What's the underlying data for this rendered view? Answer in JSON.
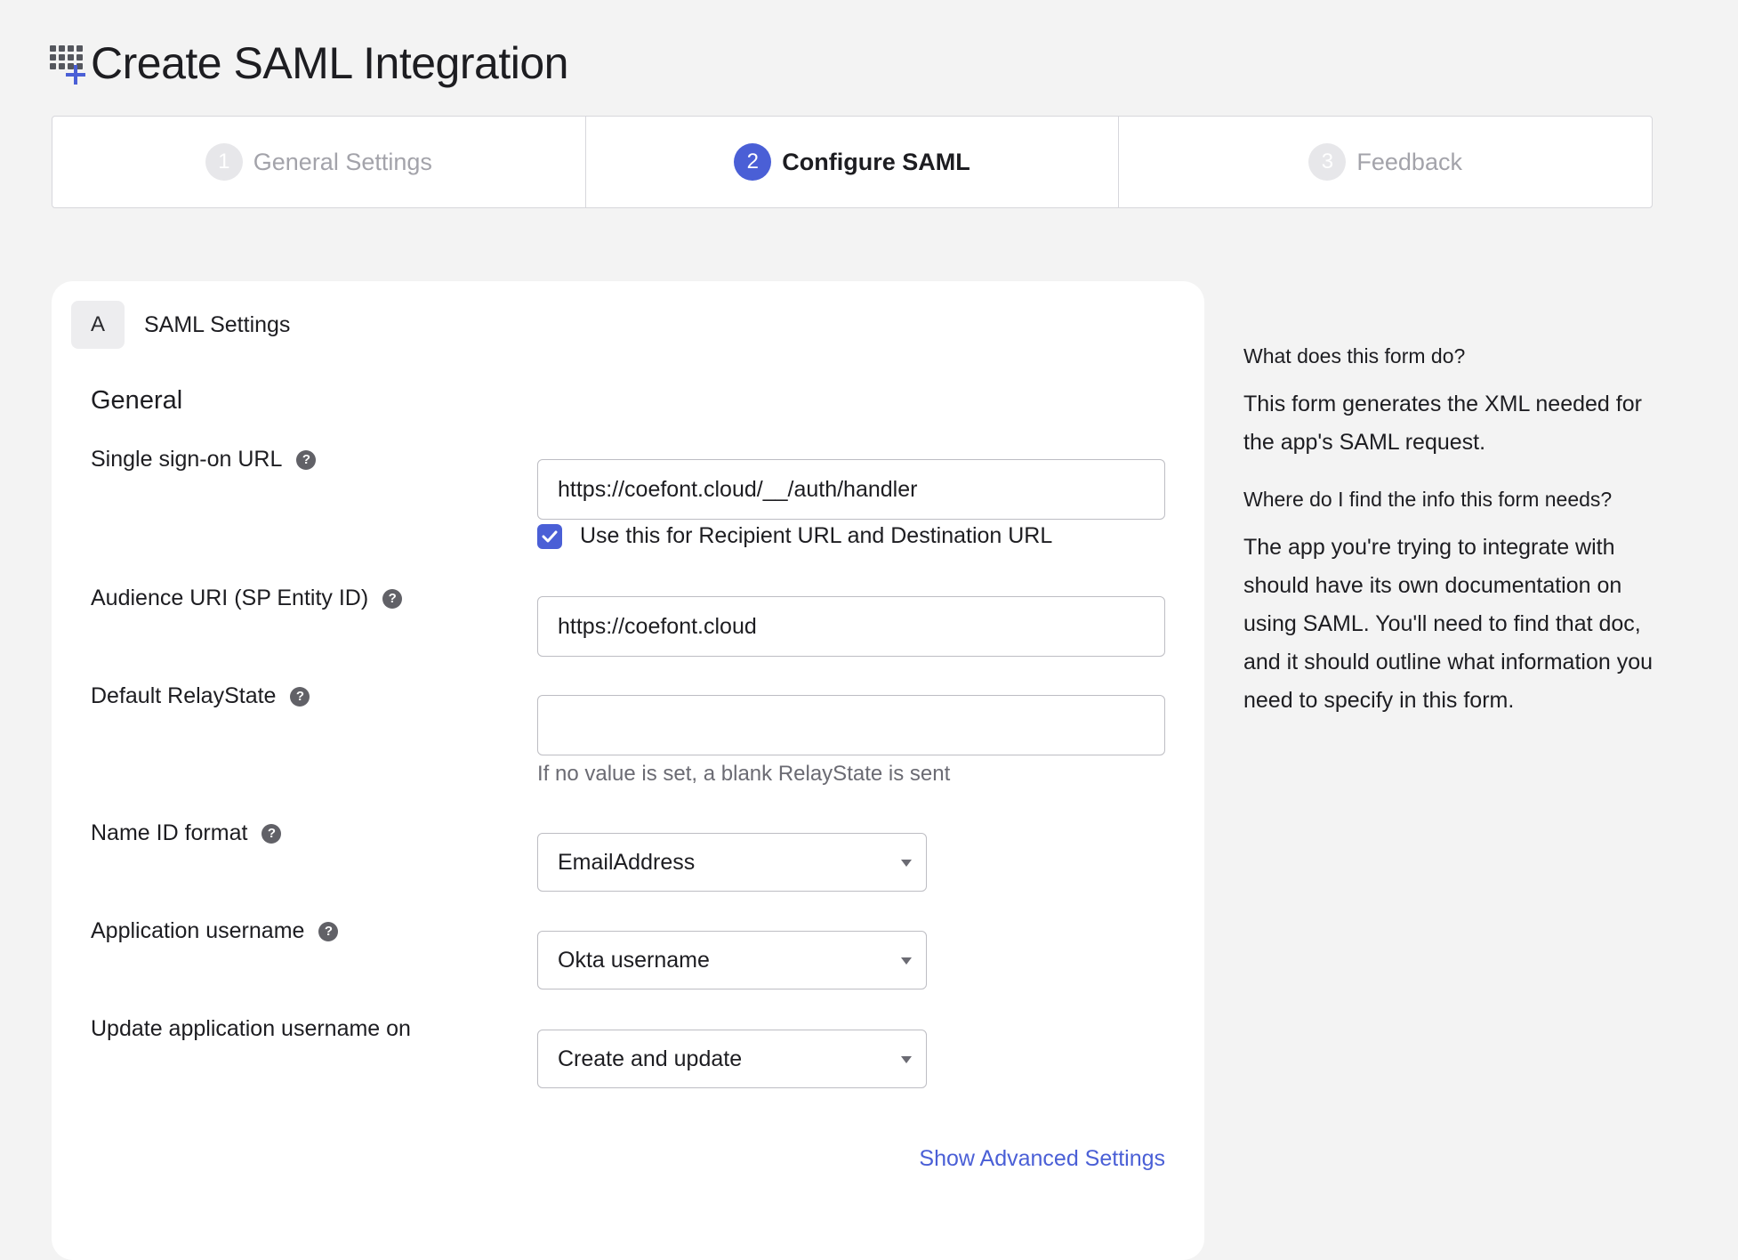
{
  "page": {
    "title": "Create SAML Integration"
  },
  "stepper": {
    "steps": [
      {
        "number": "1",
        "label": "General Settings",
        "state": "inactive"
      },
      {
        "number": "2",
        "label": "Configure SAML",
        "state": "active"
      },
      {
        "number": "3",
        "label": "Feedback",
        "state": "inactive"
      }
    ]
  },
  "section": {
    "badge": "A",
    "title": "SAML Settings",
    "group_title": "General"
  },
  "fields": {
    "sso_url": {
      "label": "Single sign-on URL",
      "value": "https://coefont.cloud/__/auth/handler",
      "checkbox_label": "Use this for Recipient URL and Destination URL",
      "checkbox_checked": true
    },
    "audience_uri": {
      "label": "Audience URI (SP Entity ID)",
      "value": "https://coefont.cloud"
    },
    "relay_state": {
      "label": "Default RelayState",
      "value": "",
      "hint": "If no value is set, a blank RelayState is sent"
    },
    "name_id_format": {
      "label": "Name ID format",
      "selected": "EmailAddress"
    },
    "app_username": {
      "label": "Application username",
      "selected": "Okta username"
    },
    "update_username_on": {
      "label": "Update application username on",
      "selected": "Create and update"
    }
  },
  "links": {
    "advanced": "Show Advanced Settings"
  },
  "help": {
    "q1": "What does this form do?",
    "a1": "This form generates the XML needed for the app's SAML request.",
    "q2": "Where do I find the info this form needs?",
    "a2": "The app you're trying to integrate with should have its own documentation on using SAML. You'll need to find that doc, and it should outline what information you need to specify in this form."
  },
  "colors": {
    "accent": "#4a5fd6",
    "background": "#f3f3f3",
    "card": "#ffffff"
  },
  "icons": {
    "title": "app-add-icon",
    "help": "question-circle-icon",
    "checkbox": "check-icon",
    "select": "caret-down-icon"
  }
}
